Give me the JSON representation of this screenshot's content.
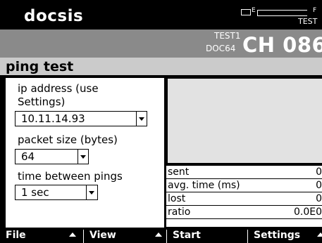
{
  "app": {
    "brand": "docsis"
  },
  "status": {
    "battery_empty_label": "E",
    "battery_full_label": "F",
    "mode_tag": "TEST",
    "test_label": "TEST1",
    "doc_label": "DOC64",
    "channel": "CH 086"
  },
  "screen": {
    "title": "ping test"
  },
  "settings": {
    "ip_label_line1": "ip address (use",
    "ip_label_line2": "Settings)",
    "ip_value": "10.11.14.93",
    "packet_label": "packet size (bytes)",
    "packet_value": "64",
    "interval_label": "time between pings",
    "interval_value": "1 sec"
  },
  "stats": {
    "rows": [
      {
        "label": "sent",
        "value": "0"
      },
      {
        "label": "avg. time (ms)",
        "value": "0"
      },
      {
        "label": "lost",
        "value": "0"
      },
      {
        "label": "ratio",
        "value": "0.0E0"
      }
    ]
  },
  "softkeys": {
    "file": "File",
    "view": "View",
    "start": "Start",
    "settings": "Settings"
  },
  "colors": {
    "channel_bar": "#8a8a8a",
    "section_header": "#cbcbcb",
    "graph_area": "#e2e2e2"
  }
}
